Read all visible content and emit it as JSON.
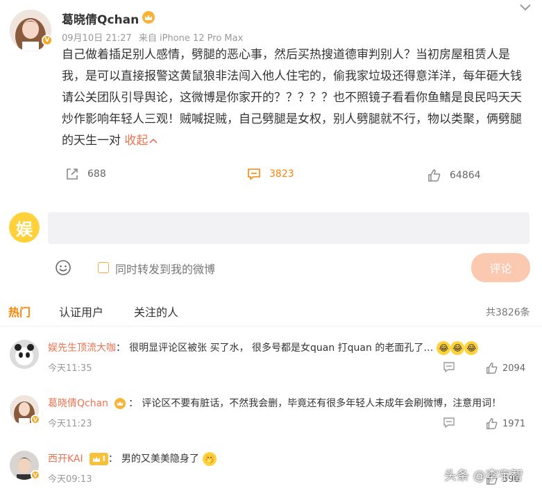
{
  "post": {
    "author": "葛晓倩Qchan",
    "time": "09月10日 21:27",
    "source": "来自 iPhone 12 Pro Max",
    "text": "自己做着插足别人感情，劈腿的恶心事，然后买热搜道德审判别人？当初房屋租赁人是我，是可以直接报警这黄鼠狼非法闯入他人住宅的，偷我家垃圾还得意洋洋，每年砸大钱请公关团队引导舆论，这微博是你家开的？？？？？也不照镜子看看你鱼鳍是良民吗天天炒作影响年轻人三观！贼喊捉贼，自己劈腿是女权，别人劈腿就不行，物以类聚，俩劈腿的天生一对",
    "collapse_label": "收起",
    "reposts": "688",
    "comments": "3823",
    "likes": "64864"
  },
  "composer": {
    "placeholder": "",
    "repost_checkbox_label": "同时转发到我的微博",
    "submit_label": "评论",
    "avatar_char": "娱"
  },
  "tabs": {
    "hot": "热门",
    "verified": "认证用户",
    "following": "关注的人",
    "total": "共3826条"
  },
  "comments": [
    {
      "name": "娱先生顶流大咖",
      "text": "很明显评论区被张 买了水，  很多号都是女quan 打quan 的老面孔了…",
      "time": "今天11:35",
      "likes": "2094"
    },
    {
      "name": "葛晓倩Qchan",
      "text": "评论区不要有脏话，不然我会删，毕竟还有很多年轻人未成年会刷微博，注意用词！",
      "time": "今天11:23",
      "likes": "1971"
    },
    {
      "name": "西开KAI",
      "text": "男的又美美隐身了",
      "time": "今天09:13",
      "likes": "596",
      "level_badge": "I"
    }
  ],
  "watermark": "头条 @李宇智",
  "colors": {
    "accent": "#ff8200",
    "name_link": "#eb7350",
    "button_disabled": "#fbc9b0"
  }
}
